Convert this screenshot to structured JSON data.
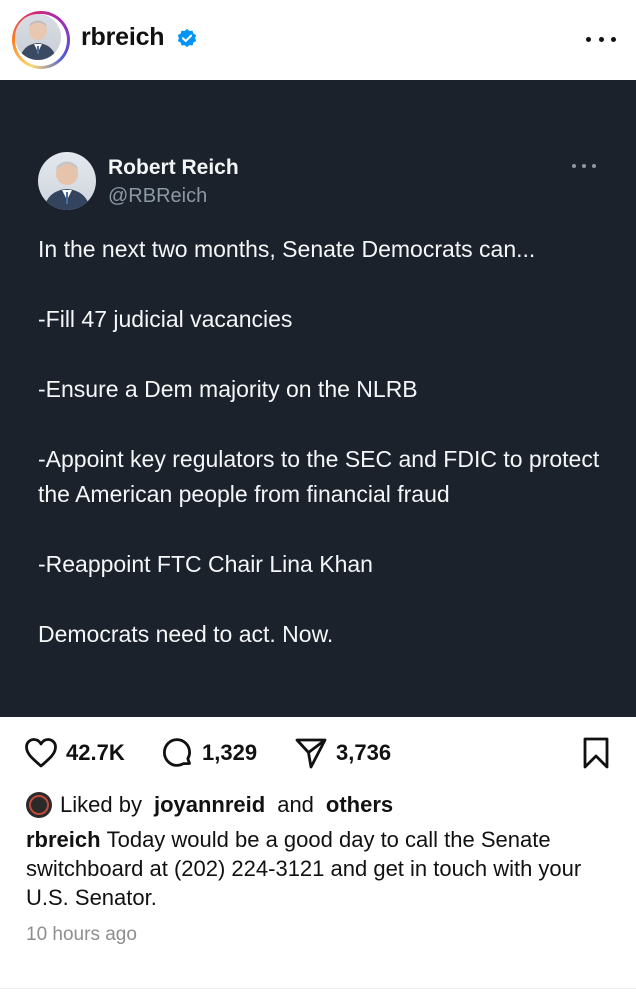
{
  "post": {
    "username": "rbreich",
    "verified_icon": "verified-badge-icon",
    "menu_icon": "more-options-icon"
  },
  "tweet": {
    "name": "Robert Reich",
    "handle": "@RBReich",
    "paragraphs": [
      "In the next two months, Senate Democrats can...",
      "-Fill 47 judicial vacancies",
      "-Ensure a Dem majority on the NLRB",
      "-Appoint key regulators to the SEC and FDIC to protect the American people from financial fraud",
      "-Reappoint FTC Chair Lina Khan",
      "Democrats need to act. Now."
    ]
  },
  "actions": {
    "likes": "42.7K",
    "comments": "1,329",
    "shares": "3,736"
  },
  "liked_by": {
    "prefix": "Liked by",
    "user": "joyannreid",
    "joiner": "and",
    "others": "others"
  },
  "caption": {
    "username": "rbreich",
    "text": "Today would be a good day to call the Senate switchboard at (202) 224-3121 and get in touch with your U.S. Senator."
  },
  "timestamp": "10 hours ago",
  "colors": {
    "tweet_bg": "#1c222c",
    "verified_blue": "#0095f6",
    "muted_text": "#8e8e8e"
  }
}
